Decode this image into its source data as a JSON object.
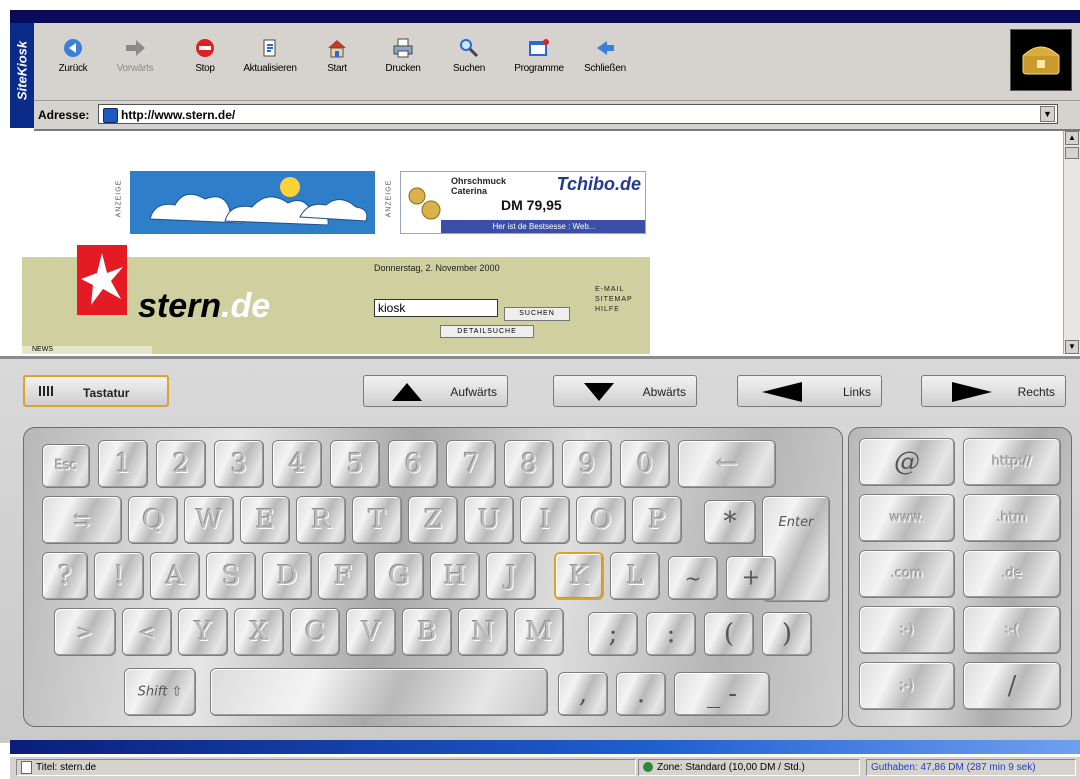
{
  "brand": {
    "name": "SiteKiosk"
  },
  "toolbar": {
    "buttons": [
      {
        "label": "Zurück",
        "icon": "back-arrow-icon",
        "enabled": true
      },
      {
        "label": "Vorwärts",
        "icon": "forward-arrow-icon",
        "enabled": false
      },
      {
        "label": "Stop",
        "icon": "stop-icon",
        "enabled": true
      },
      {
        "label": "Aktualisieren",
        "icon": "refresh-icon",
        "enabled": true
      },
      {
        "label": "Start",
        "icon": "home-icon",
        "enabled": true
      },
      {
        "label": "Drucken",
        "icon": "printer-icon",
        "enabled": true
      },
      {
        "label": "Suchen",
        "icon": "search-icon",
        "enabled": true
      },
      {
        "label": "Programme",
        "icon": "programs-icon",
        "enabled": true
      },
      {
        "label": "Schließen",
        "icon": "close-icon",
        "enabled": true
      }
    ]
  },
  "address": {
    "label": "Adresse:",
    "value": "http://www.stern.de/"
  },
  "page": {
    "ad_label": "ANZEIGE",
    "tchibo": {
      "line1": "Ohrschmuck",
      "line2": "Caterina",
      "brand": "Tchibo.de",
      "price": "DM 79,95",
      "strip": "Her ist de Bestsesse : Web..."
    },
    "stern": {
      "logo_word": "stern",
      "logo_tld": ".de",
      "date": "Donnerstag, 2. November 2000",
      "search_value": "kiosk",
      "search_button": "SUCHEN",
      "detail_button": "DETAILSUCHE",
      "links": [
        "E-MAIL",
        "SITEMAP",
        "HILFE"
      ],
      "news_tab": "NEWS"
    }
  },
  "navigation": {
    "tastatur": "Tastatur",
    "up": "Aufwärts",
    "down": "Abwärts",
    "left": "Links",
    "right": "Rechts"
  },
  "keyboard": {
    "row1": [
      "Esc",
      "1",
      "2",
      "3",
      "4",
      "5",
      "6",
      "7",
      "8",
      "9",
      "0",
      "←"
    ],
    "row2": [
      "⇆",
      "Q",
      "W",
      "E",
      "R",
      "T",
      "Z",
      "U",
      "I",
      "O",
      "P",
      "*",
      "Enter"
    ],
    "row3": [
      "?",
      "!",
      "A",
      "S",
      "D",
      "F",
      "G",
      "H",
      "J",
      "K",
      "L",
      "~",
      "+"
    ],
    "row4": [
      ">",
      "<",
      "Y",
      "X",
      "C",
      "V",
      "B",
      "N",
      "M",
      ";",
      ":",
      "(",
      ")"
    ],
    "row5": [
      "Shift ⇧",
      "",
      ",",
      ".",
      "_ -"
    ],
    "active_key": "K",
    "side": [
      "@",
      "http://",
      "www.",
      ".htm",
      ".com",
      ".de",
      ":-)",
      ":-(",
      ";-)",
      "/"
    ]
  },
  "status": {
    "title": "Titel: stern.de",
    "zone": "Zone: Standard (10,00 DM / Std.)",
    "credit": "Guthaben: 47,86 DM (287 min 9 sek)"
  },
  "colors": {
    "title_bar": "#0a0a5a",
    "brand_strip": "#0b2b8a",
    "stern_red": "#e41b22",
    "stern_panel": "#cfcf9f",
    "active_key_border": "#e0a030",
    "credit_text": "#1c3fbf"
  }
}
